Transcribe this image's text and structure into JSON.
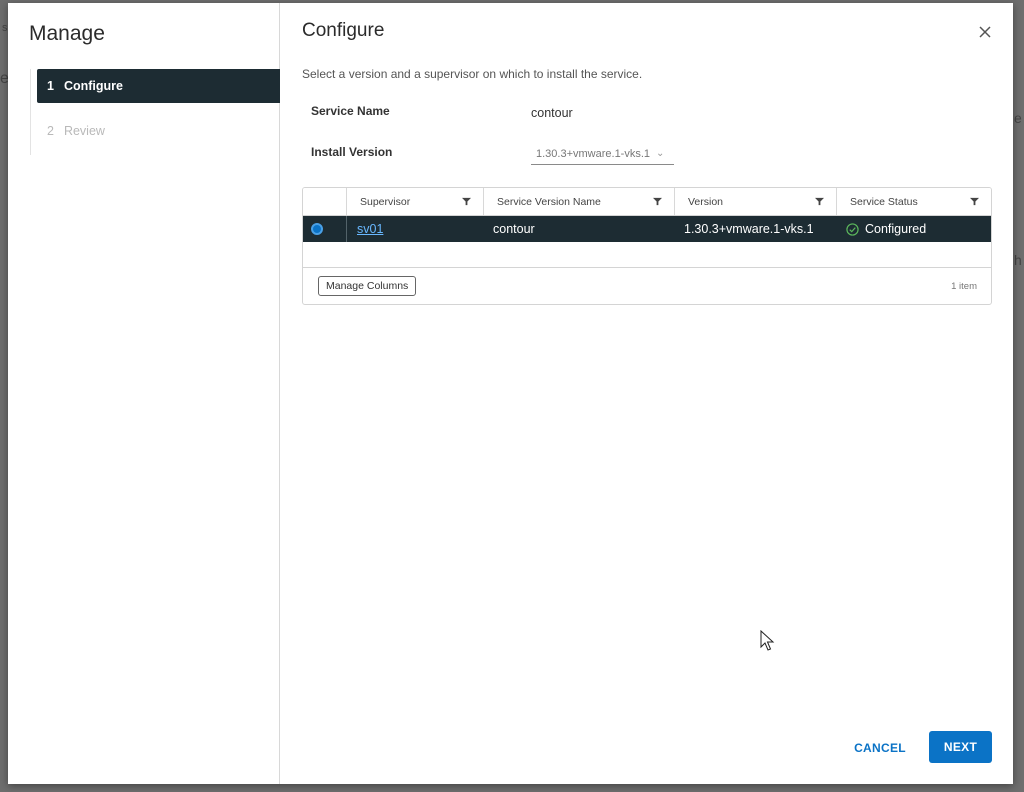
{
  "modal": {
    "left_title": "Manage",
    "steps": [
      {
        "num": "1",
        "label": "Configure"
      },
      {
        "num": "2",
        "label": "Review"
      }
    ],
    "title": "Configure",
    "description": "Select a version and a supervisor on which to install the service.",
    "service_name_label": "Service Name",
    "service_name_value": "contour",
    "install_version_label": "Install Version",
    "install_version_value": "1.30.3+vmware.1-vks.1"
  },
  "grid": {
    "columns": [
      "Supervisor",
      "Service Version Name",
      "Version",
      "Service Status"
    ],
    "rows": [
      {
        "supervisor": "sv01",
        "service_version_name": "contour",
        "version": "1.30.3+vmware.1-vks.1",
        "status": "Configured"
      }
    ],
    "manage_columns_label": "Manage Columns",
    "count_label": "1 item"
  },
  "footer": {
    "cancel_label": "CANCEL",
    "next_label": "NEXT"
  },
  "colors": {
    "primary": "#0b73c6",
    "selected_row": "#1d2c33",
    "success": "#5cb85c"
  }
}
